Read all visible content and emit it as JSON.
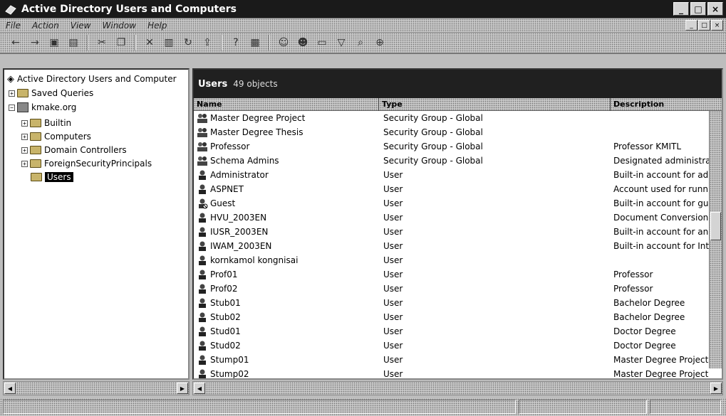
{
  "window": {
    "title": "Active Directory Users and Computers",
    "controls": [
      "_",
      "□",
      "×"
    ]
  },
  "menu": {
    "items": [
      "File",
      "Action",
      "View",
      "Window",
      "Help"
    ],
    "mdi_controls": [
      "_",
      "□",
      "×"
    ]
  },
  "toolbar": {
    "buttons": [
      "back-icon",
      "forward-icon",
      "up-icon",
      "show-hide-console-tree-icon",
      "cut-icon",
      "copy-icon",
      "delete-icon",
      "properties-icon",
      "refresh-icon",
      "export-icon",
      "help-icon",
      "new-user-icon",
      "new-group-icon",
      "new-ou-icon",
      "filter-icon",
      "find-icon",
      "add-to-group-icon"
    ]
  },
  "tree": {
    "root": "Active Directory Users and Computer",
    "saved_queries": "Saved Queries",
    "domain": "kmake.org",
    "children": [
      {
        "label": "Builtin",
        "toggle": "+"
      },
      {
        "label": "Computers",
        "toggle": "+"
      },
      {
        "label": "Domain Controllers",
        "toggle": "+"
      },
      {
        "label": "ForeignSecurityPrincipals",
        "toggle": "+"
      },
      {
        "label": "Users",
        "toggle": ""
      }
    ]
  },
  "pane": {
    "title": "Users",
    "count": "49 objects",
    "columns": [
      "Name",
      "Type",
      "Description"
    ]
  },
  "rows": [
    {
      "name": "Master Degree Project",
      "type": "Security Group - Global",
      "desc": "",
      "icon": "group"
    },
    {
      "name": "Master Degree Thesis",
      "type": "Security Group - Global",
      "desc": "",
      "icon": "group"
    },
    {
      "name": "Professor",
      "type": "Security Group - Global",
      "desc": "Professor KMITL",
      "icon": "group"
    },
    {
      "name": "Schema Admins",
      "type": "Security Group - Global",
      "desc": "Designated administrat",
      "icon": "group"
    },
    {
      "name": "Administrator",
      "type": "User",
      "desc": "Built-in account for adr",
      "icon": "user"
    },
    {
      "name": "ASPNET",
      "type": "User",
      "desc": "Account used for runni",
      "icon": "user"
    },
    {
      "name": "Guest",
      "type": "User",
      "desc": "Built-in account for gue",
      "icon": "disabled-user"
    },
    {
      "name": "HVU_2003EN",
      "type": "User",
      "desc": "Document Conversion",
      "icon": "user"
    },
    {
      "name": "IUSR_2003EN",
      "type": "User",
      "desc": "Built-in account for anc",
      "icon": "user"
    },
    {
      "name": "IWAM_2003EN",
      "type": "User",
      "desc": "Built-in account for Int",
      "icon": "user"
    },
    {
      "name": "kornkamol kongnisai",
      "type": "User",
      "desc": "",
      "icon": "user"
    },
    {
      "name": "Prof01",
      "type": "User",
      "desc": "Professor",
      "icon": "user"
    },
    {
      "name": "Prof02",
      "type": "User",
      "desc": "Professor",
      "icon": "user"
    },
    {
      "name": "Stub01",
      "type": "User",
      "desc": "Bachelor Degree",
      "icon": "user"
    },
    {
      "name": "Stub02",
      "type": "User",
      "desc": "Bachelor Degree",
      "icon": "user"
    },
    {
      "name": "Stud01",
      "type": "User",
      "desc": "Doctor Degree",
      "icon": "user"
    },
    {
      "name": "Stud02",
      "type": "User",
      "desc": "Doctor Degree",
      "icon": "user"
    },
    {
      "name": "Stump01",
      "type": "User",
      "desc": "Master Degree Project",
      "icon": "user"
    },
    {
      "name": "Stump02",
      "type": "User",
      "desc": "Master Degree Project",
      "icon": "user"
    }
  ],
  "colors": {
    "titlebar": "#1a1a1a",
    "pane_header": "#202020",
    "selection": "#000000"
  }
}
